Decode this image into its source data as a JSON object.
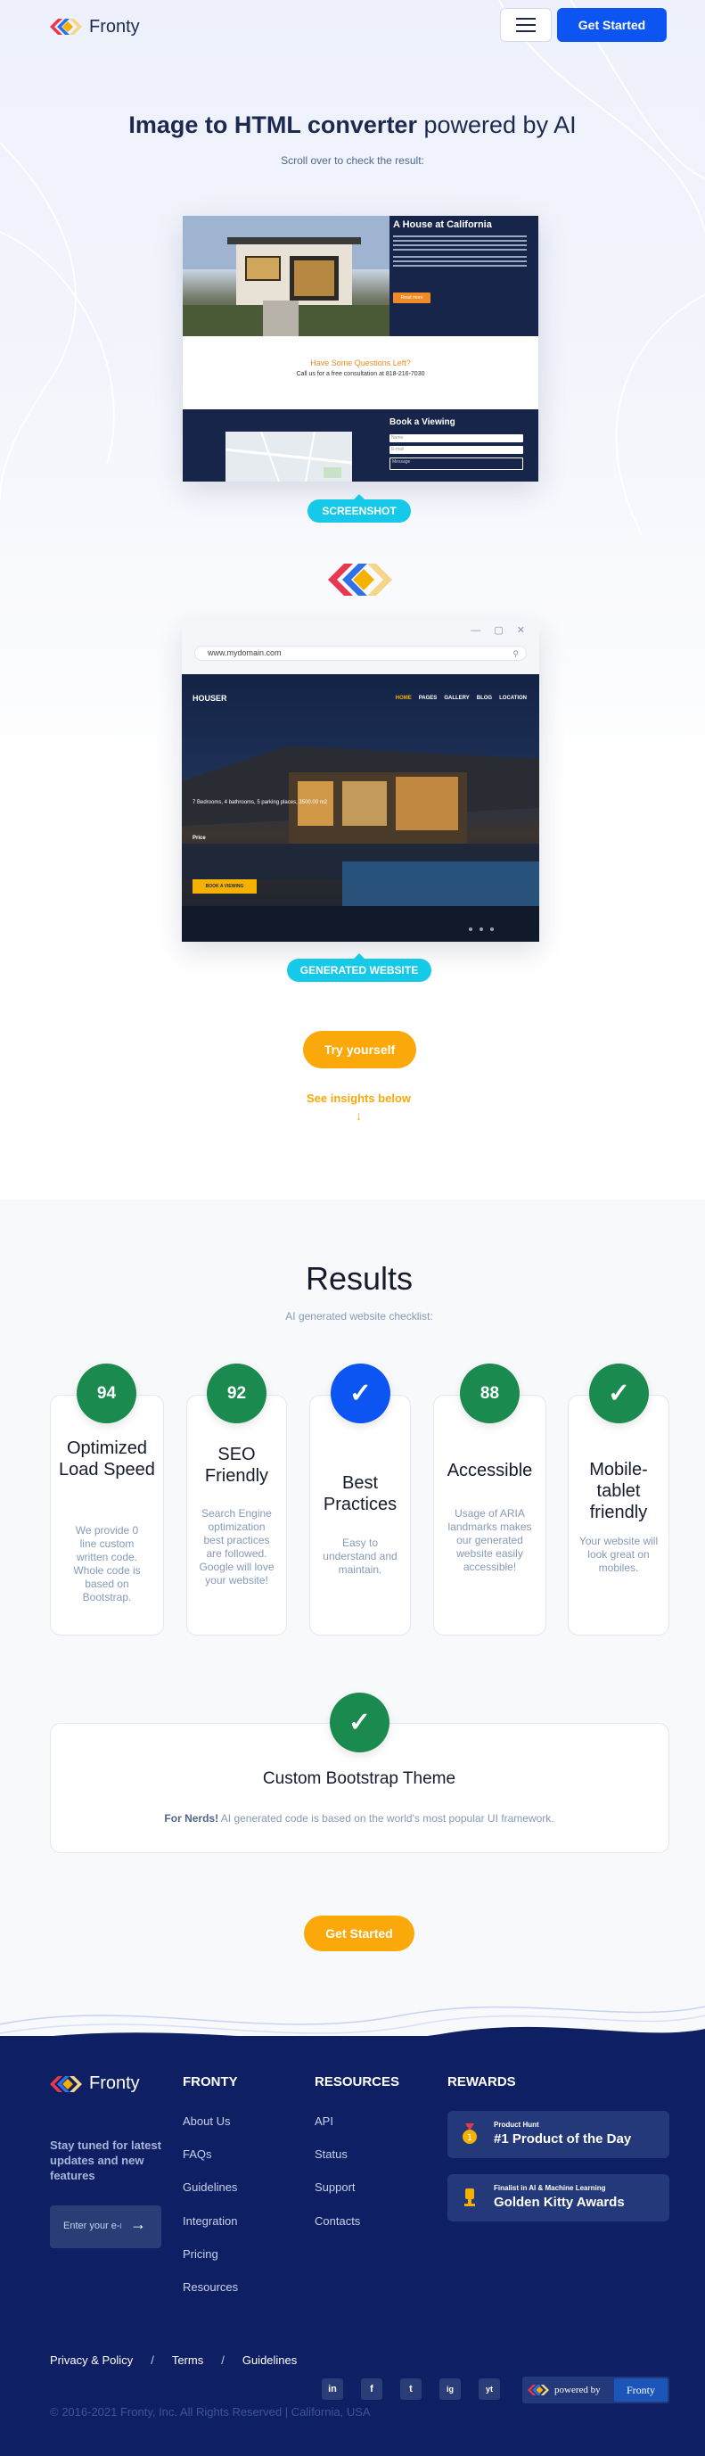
{
  "header": {
    "brand": "Fronty",
    "cta_label": "Get Started"
  },
  "hero": {
    "title_bold": "Image to HTML converter",
    "title_rest": "powered by AI",
    "subtitle": "Scroll over to check the result:",
    "screenshot_badge": "SCREENSHOT",
    "generated_badge": "GENERATED WEBSITE",
    "try_label": "Try yourself",
    "insights_label": "See insights below",
    "insights_arrow": "↓"
  },
  "screenshot": {
    "title": "A House at California",
    "button": "Read more",
    "question": "Have Some Questions Left?",
    "call": "Call us for a free consultation at 818-216-7030",
    "book": "Book a Viewing",
    "fields": [
      "Name",
      "E-mail",
      "Message"
    ]
  },
  "browser": {
    "url": "www.mydomain.com",
    "controls": "— ▢ ✕",
    "brand": "HOUSER",
    "nav": [
      "HOME",
      "PAGES",
      "GALLERY",
      "BLOG",
      "LOCATION"
    ],
    "info": "7 Bedrooms, 4 bathrooms, 5 parking places, 3500.00 m2",
    "price": "Price",
    "button": "BOOK A VIEWING"
  },
  "results": {
    "title": "Results",
    "subtitle": "AI generated website checklist:",
    "cards": [
      {
        "score": "94",
        "title": "Optimized Load Speed",
        "desc": "We provide 0 line custom written code. Whole code is based on Bootstrap.",
        "kind": "score"
      },
      {
        "score": "92",
        "title": "SEO Friendly",
        "desc": "Search Engine optimization best practices are followed. Google will love your website!",
        "kind": "score"
      },
      {
        "score": "✓",
        "title": "Best Practices",
        "desc": "Easy to understand and maintain.",
        "kind": "check-blue"
      },
      {
        "score": "88",
        "title": "Accessible",
        "desc": "Usage of ARIA landmarks makes our generated website easily accessible!",
        "kind": "score"
      },
      {
        "score": "✓",
        "title": "Mobile-tablet friendly",
        "desc": "Your website will look great on mobiles.",
        "kind": "check"
      }
    ],
    "theme_title": "Custom Bootstrap Theme",
    "theme_desc_bold": "For Nerds!",
    "theme_desc": "AI generated code is based on the world's most popular UI framework.",
    "cta_label": "Get Started"
  },
  "footer": {
    "brand": "Fronty",
    "stay": "Stay tuned for latest updates and new features",
    "input_placeholder": "Enter your e-mail",
    "col1_title": "FRONTY",
    "col1_links": [
      "About Us",
      "FAQs",
      "Guidelines",
      "Integration",
      "Pricing",
      "Resources"
    ],
    "col2_title": "RESOURCES",
    "col2_links": [
      "API",
      "Status",
      "Support",
      "Contacts"
    ],
    "col3_title": "REWARDS",
    "award1_small": "Product Hunt",
    "award1_big": "#1 Product of the Day",
    "award2_small": "Finalist in AI & Machine Learning",
    "award2_big": "Golden Kitty Awards",
    "bottom_links": [
      "Privacy & Policy",
      "Terms",
      "Guidelines"
    ],
    "separator": "/",
    "copyright": "© 2016-2021 Fronty, Inc. All Rights Reserved   |   California, USA",
    "social": [
      "in",
      "f",
      "t",
      "ig",
      "yt"
    ],
    "powered_by": "powered by",
    "powered_brand": "Fronty"
  },
  "colors": {
    "primary_blue": "#0c55f2",
    "accent_orange": "#fba80a",
    "accent_cyan": "#17c9e8",
    "score_green": "#1a8a4f",
    "footer_navy": "#0e2063"
  }
}
